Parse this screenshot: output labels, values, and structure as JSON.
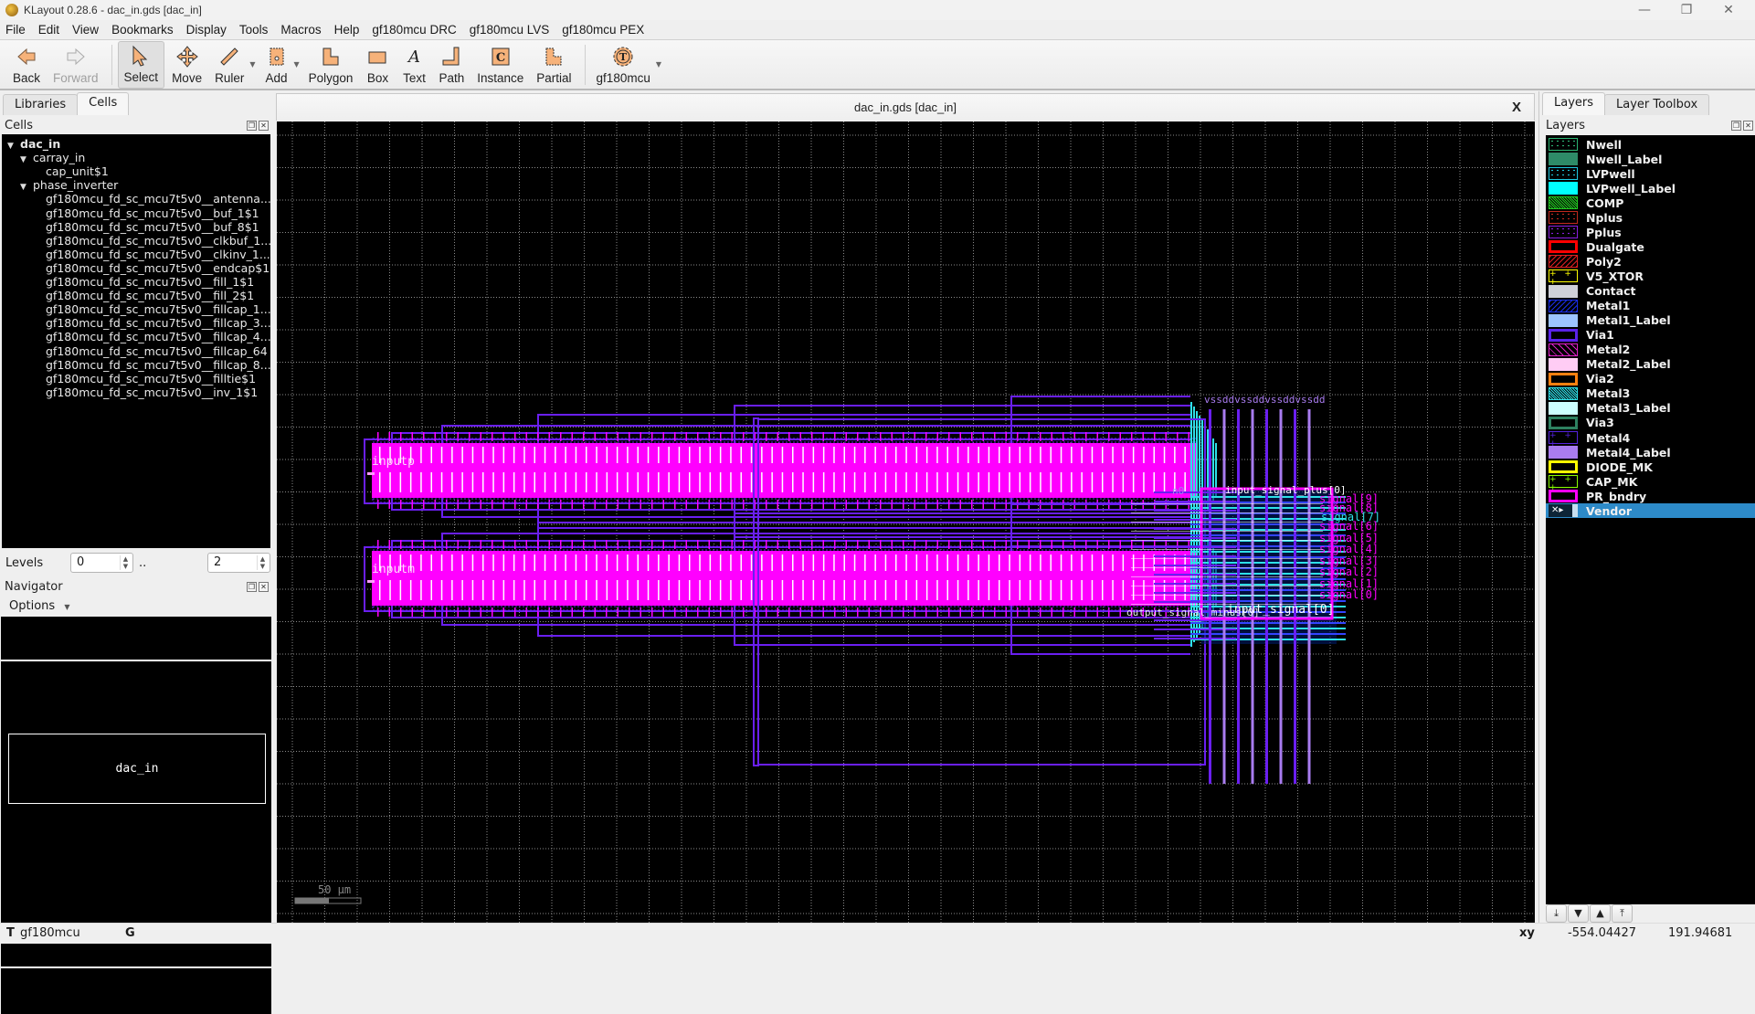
{
  "window": {
    "title": "KLayout 0.28.6 - dac_in.gds [dac_in]",
    "minimize": "—",
    "maximize": "❐",
    "close": "✕"
  },
  "menu": [
    "File",
    "Edit",
    "View",
    "Bookmarks",
    "Display",
    "Tools",
    "Macros",
    "Help",
    "gf180mcu DRC",
    "gf180mcu LVS",
    "gf180mcu PEX"
  ],
  "toolbar": {
    "back": "Back",
    "forward": "Forward",
    "select": "Select",
    "move": "Move",
    "ruler": "Ruler",
    "add": "Add",
    "polygon": "Polygon",
    "box": "Box",
    "text": "Text",
    "path": "Path",
    "instance": "Instance",
    "partial": "Partial",
    "tech": "gf180mcu"
  },
  "left_panel": {
    "tabs": [
      "Libraries",
      "Cells"
    ],
    "active_tab": "Cells",
    "cells_header": "Cells",
    "tree": [
      {
        "label": "dac_in",
        "level": 0,
        "expanded": true,
        "bold": true
      },
      {
        "label": "carray_in",
        "level": 1,
        "expanded": true
      },
      {
        "label": "cap_unit$1",
        "level": 2
      },
      {
        "label": "phase_inverter",
        "level": 1,
        "expanded": true
      },
      {
        "label": "gf180mcu_fd_sc_mcu7t5v0__antenna...",
        "level": 2
      },
      {
        "label": "gf180mcu_fd_sc_mcu7t5v0__buf_1$1",
        "level": 2
      },
      {
        "label": "gf180mcu_fd_sc_mcu7t5v0__buf_8$1",
        "level": 2
      },
      {
        "label": "gf180mcu_fd_sc_mcu7t5v0__clkbuf_1...",
        "level": 2
      },
      {
        "label": "gf180mcu_fd_sc_mcu7t5v0__clkinv_1...",
        "level": 2
      },
      {
        "label": "gf180mcu_fd_sc_mcu7t5v0__endcap$1",
        "level": 2
      },
      {
        "label": "gf180mcu_fd_sc_mcu7t5v0__fill_1$1",
        "level": 2
      },
      {
        "label": "gf180mcu_fd_sc_mcu7t5v0__fill_2$1",
        "level": 2
      },
      {
        "label": "gf180mcu_fd_sc_mcu7t5v0__fillcap_1...",
        "level": 2
      },
      {
        "label": "gf180mcu_fd_sc_mcu7t5v0__fillcap_3...",
        "level": 2
      },
      {
        "label": "gf180mcu_fd_sc_mcu7t5v0__fillcap_4...",
        "level": 2
      },
      {
        "label": "gf180mcu_fd_sc_mcu7t5v0__fillcap_64",
        "level": 2
      },
      {
        "label": "gf180mcu_fd_sc_mcu7t5v0__fillcap_8...",
        "level": 2
      },
      {
        "label": "gf180mcu_fd_sc_mcu7t5v0__filltie$1",
        "level": 2
      },
      {
        "label": "gf180mcu_fd_sc_mcu7t5v0__inv_1$1",
        "level": 2
      }
    ],
    "levels_label": "Levels",
    "level_from": "0",
    "level_sep": "..",
    "level_to": "2",
    "navigator_header": "Navigator",
    "options_label": "Options",
    "navigator_cell": "dac_in"
  },
  "view": {
    "title": "dac_in.gds [dac_in]",
    "close": "X",
    "scale_label": "50 µm",
    "labels": {
      "inputp": "inputp",
      "inputm": "inputm",
      "power": "vssddvssddvssddvssdd",
      "n0": "n0",
      "sig_plus0": "input_signal_plus[0]",
      "sig0": "input_signal[0]",
      "out_minus": "output_signal_minus[0]",
      "right_labels_magenta": [
        "signal[9]",
        "signal[8]",
        "signal[6]",
        "signal[5]",
        "signal[4]",
        "signal[3]",
        "signal[2]",
        "signal[1]",
        "signal[0]"
      ],
      "right_label_cyan": "signal[7]"
    }
  },
  "right_panel": {
    "tabs": [
      "Layers",
      "Layer Toolbox"
    ],
    "active_tab": "Layers",
    "header": "Layers",
    "layers": [
      {
        "name": "Nwell",
        "color": "#2bb673",
        "style": "dots"
      },
      {
        "name": "Nwell_Label",
        "color": "#2e8b68",
        "style": "solid"
      },
      {
        "name": "LVPwell",
        "color": "#1ec8e0",
        "style": "dots"
      },
      {
        "name": "LVPwell_Label",
        "color": "#00ffff",
        "style": "solid"
      },
      {
        "name": "COMP",
        "color": "#22cc22",
        "style": "dense"
      },
      {
        "name": "Nplus",
        "color": "#c0281e",
        "style": "dots"
      },
      {
        "name": "Pplus",
        "color": "#8a1ee0",
        "style": "dots"
      },
      {
        "name": "Dualgate",
        "color": "#ff0000",
        "style": "thick"
      },
      {
        "name": "Poly2",
        "color": "#e02020",
        "style": "hatch"
      },
      {
        "name": "V5_XTOR",
        "color": "#ffff00",
        "style": "cross"
      },
      {
        "name": "Contact",
        "color": "#cfd0d8",
        "style": "solid"
      },
      {
        "name": "Metal1",
        "color": "#1a2ee8",
        "style": "hatch"
      },
      {
        "name": "Metal1_Label",
        "color": "#9cc4ff",
        "style": "solid"
      },
      {
        "name": "Via1",
        "color": "#5a22e8",
        "style": "thick"
      },
      {
        "name": "Metal2",
        "color": "#e020c8",
        "style": "backhatch"
      },
      {
        "name": "Metal2_Label",
        "color": "#ffccf4",
        "style": "solid"
      },
      {
        "name": "Via2",
        "color": "#ff8010",
        "style": "thick"
      },
      {
        "name": "Metal3",
        "color": "#2ee0e8",
        "style": "dense"
      },
      {
        "name": "Metal3_Label",
        "color": "#ccffff",
        "style": "solid"
      },
      {
        "name": "Via3",
        "color": "#2e8060",
        "style": "thick"
      },
      {
        "name": "Metal4",
        "color": "#5522dd",
        "style": "cross"
      },
      {
        "name": "Metal4_Label",
        "color": "#a97cf0",
        "style": "solid"
      },
      {
        "name": "DIODE_MK",
        "color": "#ffff00",
        "style": "thick"
      },
      {
        "name": "CAP_MK",
        "color": "#88ff00",
        "style": "cross"
      },
      {
        "name": "PR_bndry",
        "color": "#ff00ff",
        "style": "thick"
      },
      {
        "name": "Vendor",
        "color": "#2d8ac8",
        "style": "selected"
      }
    ],
    "selected_layer": "Vendor",
    "buttons": [
      "move-to-bottom",
      "move-down",
      "move-up",
      "move-to-top"
    ]
  },
  "status": {
    "tech_prefix": "T",
    "tech": "gf180mcu",
    "grid_flag": "G",
    "coord_label": "xy",
    "x": "-554.04427",
    "y": "191.94681"
  }
}
